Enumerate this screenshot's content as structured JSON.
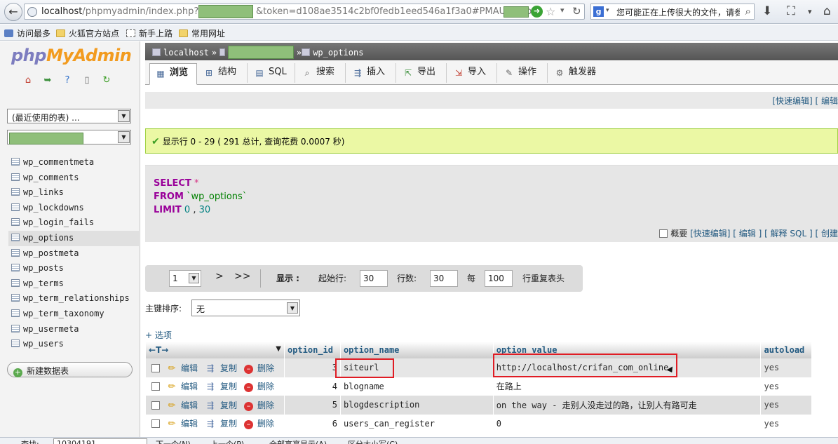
{
  "browser": {
    "url_prefix": "localhost",
    "url_path": "/phpmyadmin/index.php?db=",
    "url_mid": "&token=d108ae3514c2bf0fedb1eed546a1f3a0#PMAURL:db=",
    "search_text": "您可能正在上传很大的文件，请参"
  },
  "bookmarks": [
    "访问最多",
    "火狐官方站点",
    "新手上路",
    "常用网址"
  ],
  "sidebar": {
    "logo_a": "php",
    "logo_b": "MyAdmin",
    "recent_tables": "(最近使用的表) ...",
    "tables": [
      "wp_commentmeta",
      "wp_comments",
      "wp_links",
      "wp_lockdowns",
      "wp_login_fails",
      "wp_options",
      "wp_postmeta",
      "wp_posts",
      "wp_terms",
      "wp_term_relationships",
      "wp_term_taxonomy",
      "wp_usermeta",
      "wp_users"
    ],
    "new_db": "新建数据表"
  },
  "breadcrumb": {
    "server": "localhost",
    "sep": "»",
    "table": "wp_options"
  },
  "tabs": [
    "浏览",
    "结构",
    "SQL",
    "搜索",
    "插入",
    "导出",
    "导入",
    "操作",
    "触发器"
  ],
  "quick_edit_bar": "[快速编辑] [ 编辑",
  "status": "显示行 0 - 29 ( 291 总计, 查询花费 0.0007 秒)",
  "sql": {
    "select": "SELECT",
    "star": "*",
    "from": "FROM",
    "table": "`wp_options`",
    "limit": "LIMIT",
    "limit_a": "0",
    "comma": ",",
    "limit_b": "30"
  },
  "sql_links": {
    "profiling": "概要",
    "quick_edit": "[快速编辑]",
    "edit": "[ 编辑 ]",
    "explain": "[ 解释 SQL ]",
    "create": "[ 创建"
  },
  "nav": {
    "page": "1",
    "next": ">",
    "last": ">>",
    "show_label": "显示 :",
    "start_label": "起始行:",
    "start_value": "30",
    "rows_label": "行数:",
    "rows_value": "30",
    "every_label": "每",
    "every_value": "100",
    "repeat_label": "行重复表头"
  },
  "sort": {
    "label": "主键排序:",
    "value": "无"
  },
  "options_link": "+ 选项",
  "grid": {
    "arrows": "←T→",
    "headers": [
      "option_id",
      "option_name",
      "option_value",
      "autoload"
    ],
    "actions": {
      "edit": "编辑",
      "copy": "复制",
      "delete": "删除"
    },
    "rows": [
      {
        "id": "3",
        "name": "siteurl",
        "value": "http://localhost/crifan_com_online",
        "autoload": "yes"
      },
      {
        "id": "4",
        "name": "blogname",
        "value": "在路上",
        "autoload": "yes"
      },
      {
        "id": "5",
        "name": "blogdescription",
        "value": "on the way - 走别人没走过的路，让别人有路可走",
        "autoload": "yes"
      },
      {
        "id": "6",
        "name": "users_can_register",
        "value": "0",
        "autoload": "yes"
      }
    ]
  },
  "findbar": {
    "label": "查找:",
    "value": "10304191",
    "next": "下一个(N)",
    "prev": "上一个(P)",
    "highlight": "全部高亮显示(A)",
    "match_case": "区分大小写(C)"
  },
  "colors": {
    "accent": "#235a81",
    "highlight": "#e01c24",
    "success_bg": "#ebf8a4"
  }
}
